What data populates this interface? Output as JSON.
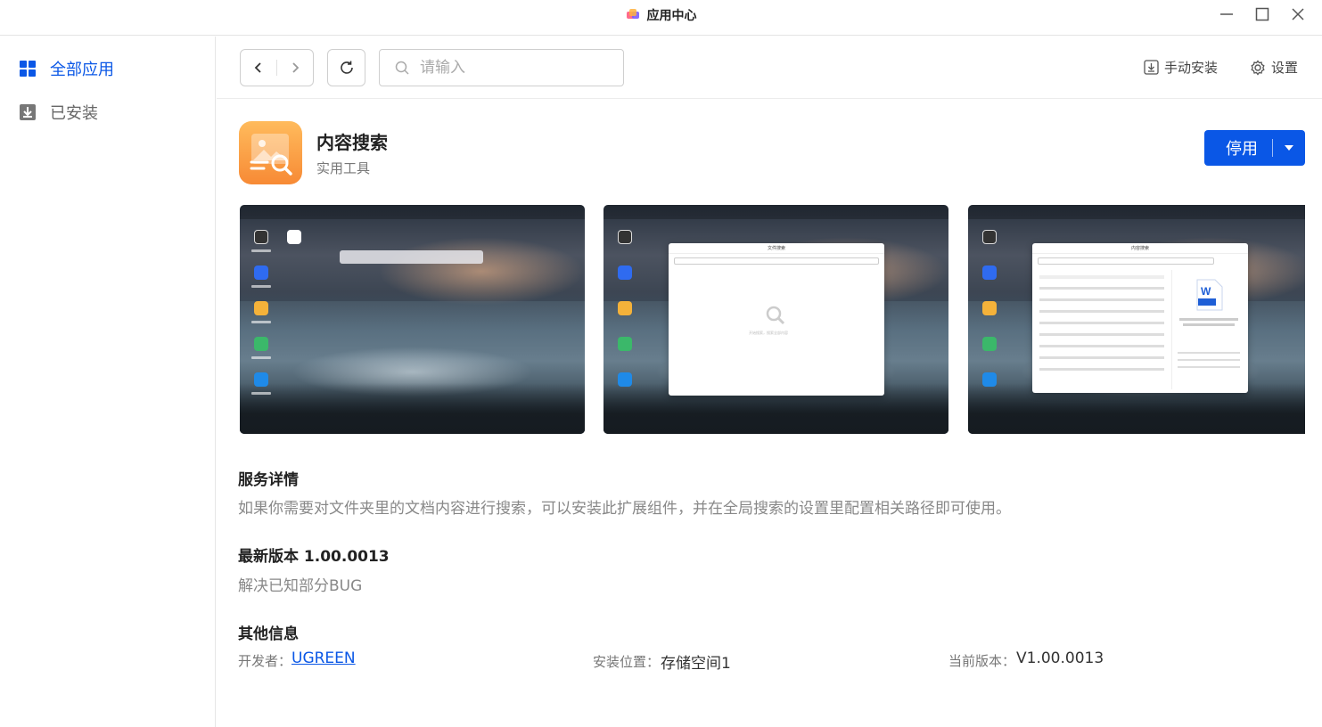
{
  "window": {
    "title": "应用中心"
  },
  "sidebar": {
    "items": [
      {
        "label": "全部应用",
        "icon": "grid-icon",
        "active": true
      },
      {
        "label": "已安装",
        "icon": "download-box-icon",
        "active": false
      }
    ]
  },
  "toolbar": {
    "search_placeholder": "请输入",
    "manual_install_label": "手动安装",
    "settings_label": "设置"
  },
  "app": {
    "name": "内容搜索",
    "category": "实用工具",
    "primary_action": "停用"
  },
  "screenshots": {
    "shot2_window_title": "文件搜索",
    "shot2_hint": "开始搜索，搜索全部内容",
    "shot3_window_title": "内容搜索"
  },
  "details": {
    "service_title": "服务详情",
    "service_desc": "如果你需要对文件夹里的文档内容进行搜索，可以安装此扩展组件，并在全局搜索的设置里配置相关路径即可使用。",
    "version_title": "最新版本 1.00.0013",
    "version_notes": "解决已知部分BUG",
    "other_title": "其他信息",
    "developer_label": "开发者：",
    "developer_value": "UGREEN",
    "install_location_label": "安装位置：",
    "install_location_value": "存储空间1",
    "current_version_label": "当前版本：",
    "current_version_value": "V1.00.0013"
  },
  "colors": {
    "accent": "#0a57e6",
    "app_icon_top": "#ffbb5c",
    "app_icon_bottom": "#f78a35"
  }
}
